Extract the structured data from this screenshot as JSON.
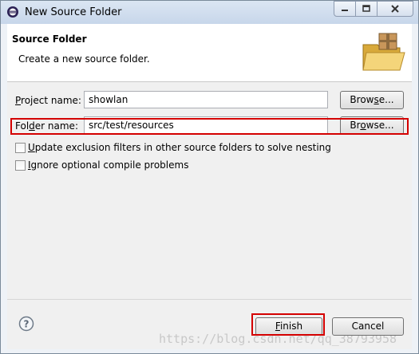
{
  "window": {
    "title": "New Source Folder"
  },
  "header": {
    "title": "Source Folder",
    "description": "Create a new source folder."
  },
  "form": {
    "project": {
      "label_mnemonic": "P",
      "label_rest": "roject name:",
      "value": "showlan",
      "browse_pre": "Brow",
      "browse_u": "s",
      "browse_post": "e..."
    },
    "folder": {
      "label_pre": "Fol",
      "label_u": "d",
      "label_post": "er name:",
      "value": "src/test/resources",
      "browse_pre": "Br",
      "browse_u": "o",
      "browse_post": "wse..."
    },
    "update_exclusion": {
      "mnemonic": "U",
      "rest": "pdate exclusion filters in other source folders to solve nesting",
      "checked": false
    },
    "ignore_optional": {
      "mnemonic": "I",
      "rest": "gnore optional compile problems",
      "checked": false
    }
  },
  "footer": {
    "finish_mnemonic": "F",
    "finish_rest": "inish",
    "cancel": "Cancel",
    "watermark": "https://blog.csdn.net/qq_38793958"
  },
  "colors": {
    "highlight": "#d40000",
    "icon": "help-icon"
  }
}
